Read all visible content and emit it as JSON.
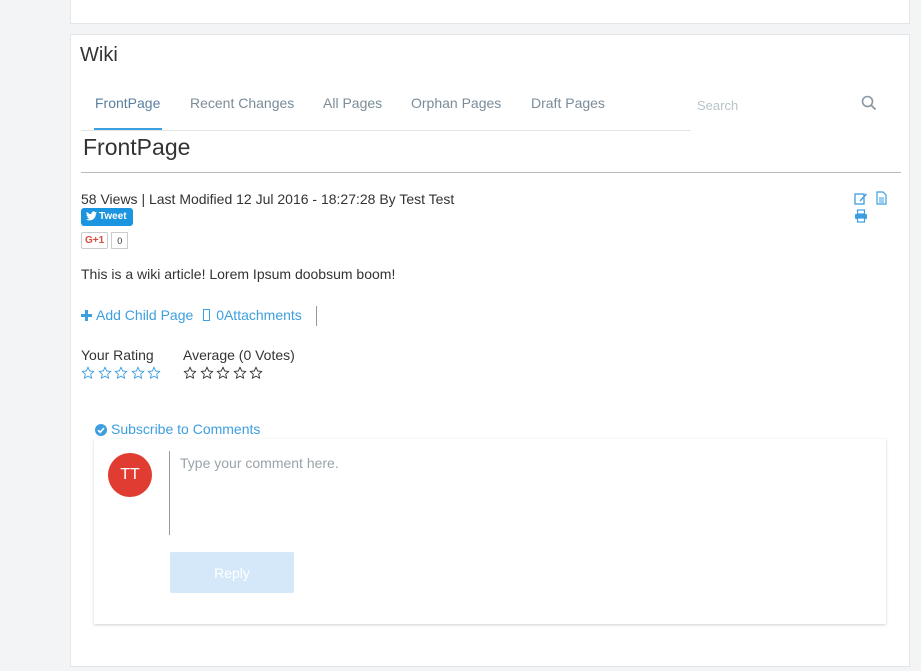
{
  "wiki": {
    "title": "Wiki"
  },
  "tabs": [
    {
      "label": "FrontPage",
      "active": true
    },
    {
      "label": "Recent Changes"
    },
    {
      "label": "All Pages"
    },
    {
      "label": "Orphan Pages"
    },
    {
      "label": "Draft Pages"
    }
  ],
  "search": {
    "placeholder": "Search",
    "icon": "search-icon"
  },
  "page": {
    "title": "FrontPage",
    "meta": "58 Views | Last Modified 12 Jul 2016 - 18:27:28 By Test Test",
    "actions": [
      "edit-icon",
      "document-icon",
      "print-icon"
    ],
    "content": "This is a wiki article! Lorem Ipsum doobsum boom!"
  },
  "social": {
    "tweet_label": "Tweet",
    "gplus_label": "G+1",
    "gplus_count": "0"
  },
  "page_actions": {
    "add_child": "Add Child Page",
    "attachments": "0Attachments"
  },
  "rating": {
    "your_label": "Your Rating",
    "average_label": "Average (0 Votes)",
    "your_value": 0,
    "average_value": 0,
    "max": 5
  },
  "comments": {
    "subscribe_label": "Subscribe to Comments",
    "avatar_initials": "TT",
    "placeholder": "Type your comment here.",
    "reply_label": "Reply"
  },
  "colors": {
    "accent": "#3d9fe0",
    "avatar": "#e03c31",
    "reply_button": "#d4e8fa"
  }
}
